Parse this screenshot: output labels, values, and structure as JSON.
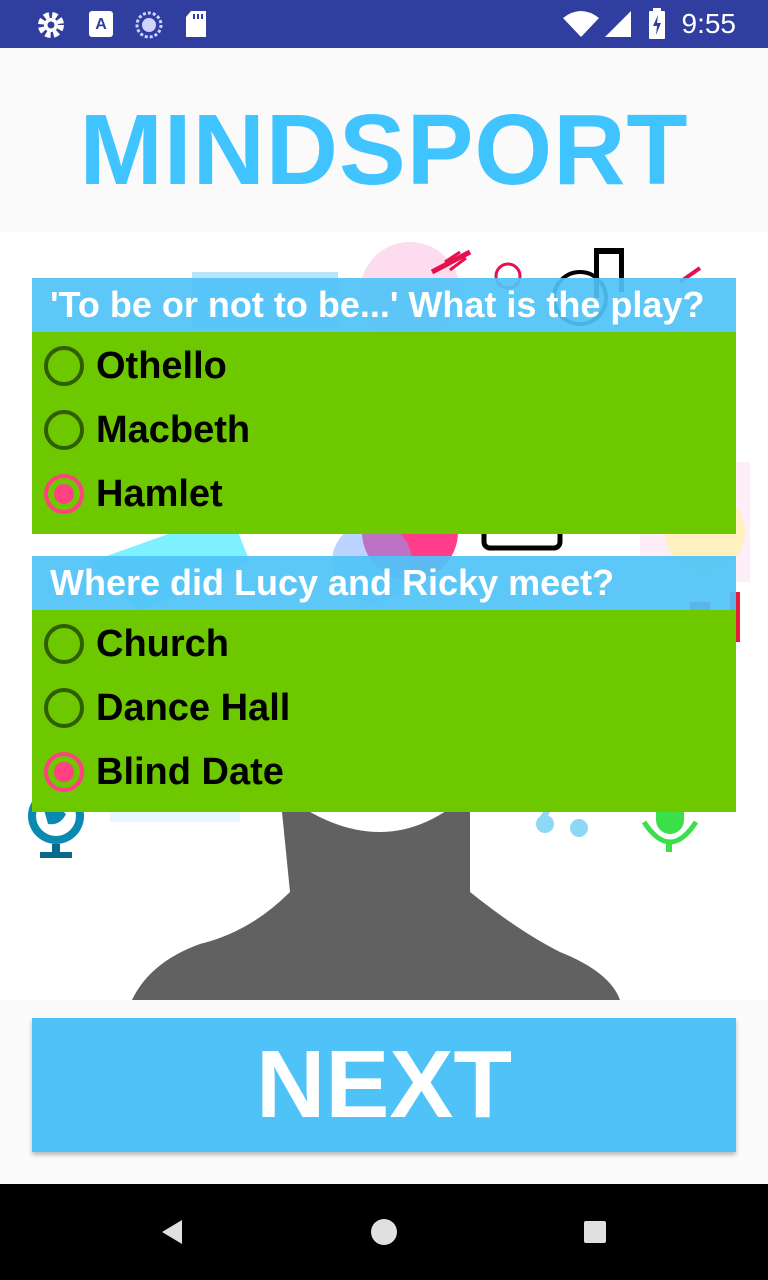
{
  "status_bar": {
    "time": "9:55",
    "left_icons": [
      "gear-icon",
      "font-a-icon",
      "sync-circle-icon",
      "sd-card-icon"
    ],
    "right_icons": [
      "wifi-icon",
      "signal-icon",
      "battery-charging-icon"
    ]
  },
  "header": {
    "title": "MINDSPORT"
  },
  "questions": [
    {
      "text": "'To be or not to be...' What is the play?",
      "options": [
        "Othello",
        "Macbeth",
        "Hamlet"
      ],
      "selected": "Hamlet"
    },
    {
      "text": "Where did Lucy and Ricky meet?",
      "options": [
        "Church",
        "Dance Hall",
        "Blind Date"
      ],
      "selected": "Blind Date"
    }
  ],
  "next_button": {
    "label": "NEXT"
  },
  "nav_bar": {
    "icons": [
      "back-icon",
      "home-icon",
      "recents-icon"
    ]
  },
  "colors": {
    "status_bar": "#303f9f",
    "title": "#40c4ff",
    "question_header": "#4fc3f7",
    "options_bg": "#6ec800",
    "radio_selected": "#ff4081",
    "radio_unselected": "#2e5e00",
    "next_button": "#4fc3f7"
  }
}
